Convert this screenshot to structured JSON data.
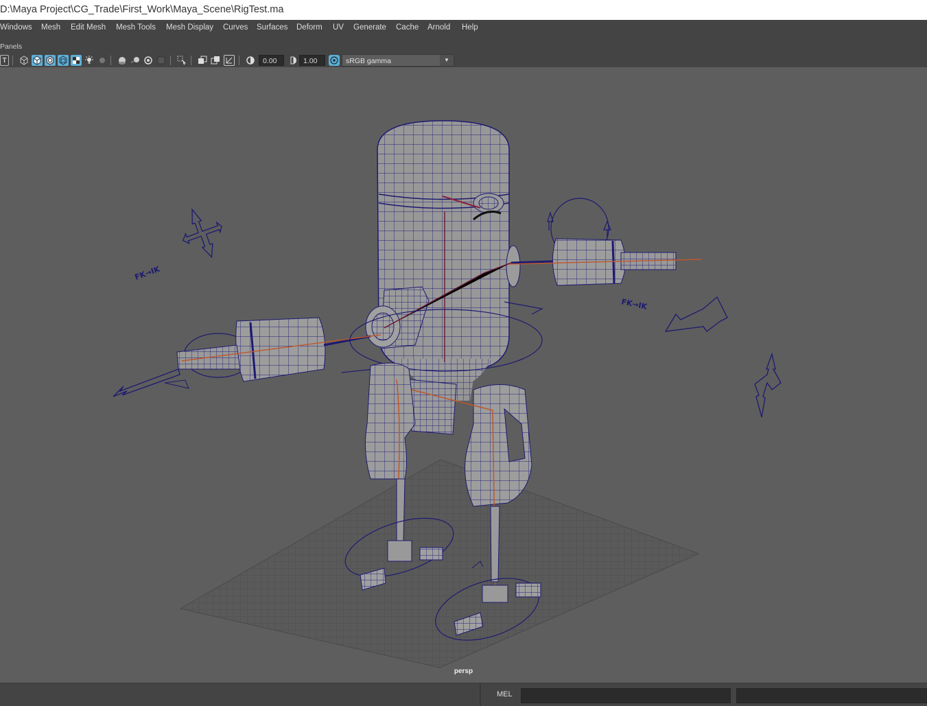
{
  "window": {
    "title": "D:\\Maya Project\\CG_Trade\\First_Work\\Maya_Scene\\RigTest.ma"
  },
  "menubar": {
    "items": [
      "Windows",
      "Mesh",
      "Edit Mesh",
      "Mesh Tools",
      "Mesh Display",
      "Curves",
      "Surfaces",
      "Deform",
      "UV",
      "Generate",
      "Cache",
      "Arnold",
      "Help"
    ]
  },
  "panel": {
    "label": "Panels",
    "toolbar": {
      "text_icon": "T",
      "exposure_value": "0.00",
      "gamma_value": "1.00",
      "color_space": "sRGB gamma",
      "icons": [
        "texture-icon",
        "wireframe-cube-icon",
        "smooth-shade-icon",
        "shade-wireframe-icon",
        "xray-icon",
        "checker-icon",
        "light-icon",
        "shadow-icon",
        "ambient-occlusion-icon",
        "motion-blur-icon",
        "antialias-icon",
        "isolate-select-icon",
        "xray-joints-icon",
        "resolution-gate-icon",
        "exposure-icon",
        "gamma-icon",
        "color-management-icon"
      ]
    }
  },
  "viewport": {
    "camera": "persp",
    "labels": {
      "fk_ik_left": "FK→IK",
      "fk_ik_right": "FK→IK"
    }
  },
  "statusbar": {
    "mel_label": "MEL"
  },
  "colors": {
    "background": "#5e5e5e",
    "wire": "#1c1a78",
    "joint": "#c0572a",
    "accent": "#5db0d6"
  }
}
